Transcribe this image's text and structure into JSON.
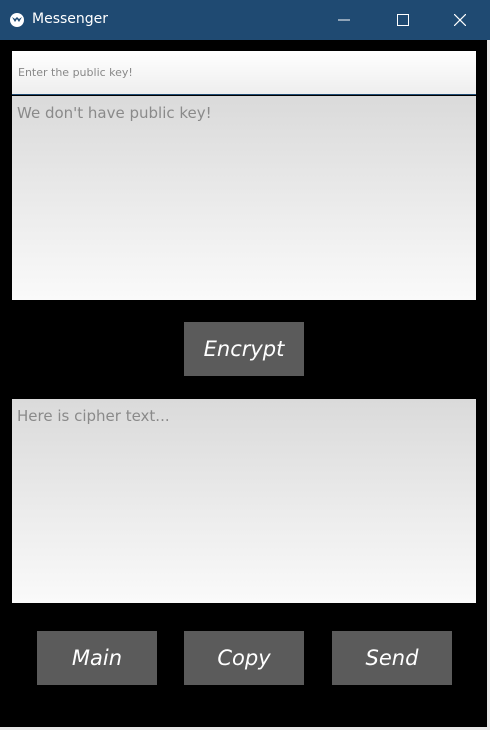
{
  "window": {
    "title": "Messenger",
    "icon": "kivy-icon",
    "controls": {
      "minimize_icon": "minimize-icon",
      "maximize_icon": "maximize-icon",
      "close_icon": "close-icon"
    }
  },
  "public_key": {
    "value": "",
    "placeholder": "Enter the public key!"
  },
  "plain_text": {
    "value": "",
    "placeholder": "We don't have public key!"
  },
  "encrypt_button": {
    "label": "Encrypt"
  },
  "cipher_text": {
    "value": "",
    "placeholder": "Here is cipher text..."
  },
  "actions": {
    "main_label": "Main",
    "copy_label": "Copy",
    "send_label": "Send"
  },
  "colors": {
    "titlebar": "#1f4a72",
    "background": "#000000",
    "button": "#5b5b5b",
    "button_text": "#ffffff"
  }
}
